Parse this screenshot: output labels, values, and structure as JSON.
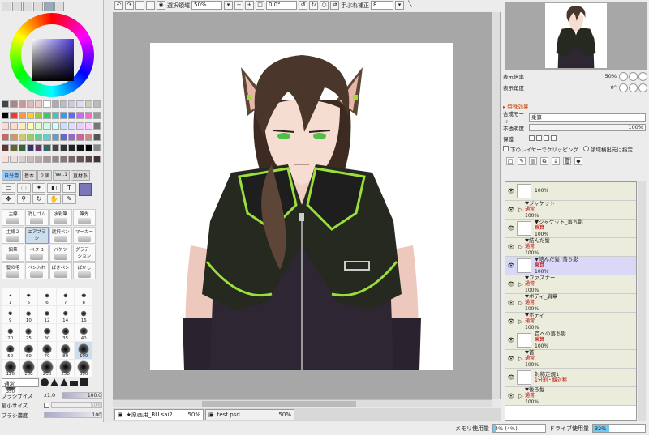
{
  "toolbar": {
    "selection_label": "選択領域",
    "zoom": "50%",
    "rotation": "0.0°",
    "stabilizer_label": "手ぶれ補正",
    "stabilizer_value": "8"
  },
  "left": {
    "tool_tabs": [
      "自分用",
      "基本",
      "２値",
      "Ver.1",
      "直材系"
    ],
    "brushes": [
      {
        "label": "主線"
      },
      {
        "label": "消しゴム"
      },
      {
        "label": "水彩筆"
      },
      {
        "label": "筆先"
      },
      {
        "label": "主線２"
      },
      {
        "label": "エアブラシ",
        "selected": true
      },
      {
        "label": "選択ペン"
      },
      {
        "label": "マーカー"
      },
      {
        "label": "鉛筆"
      },
      {
        "label": "ベタ B"
      },
      {
        "label": "バケツ"
      },
      {
        "label": "グラデーション"
      },
      {
        "label": "髪の毛"
      },
      {
        "label": "ペン入れ"
      },
      {
        "label": "ぼきペン"
      },
      {
        "label": "ぼかし"
      }
    ],
    "sizes": [
      "1",
      "5",
      "6",
      "7",
      "8",
      "9",
      "10",
      "12",
      "14",
      "16",
      "20",
      "25",
      "30",
      "35",
      "40",
      "50",
      "60",
      "70",
      "80",
      "100",
      "120",
      "160",
      "200",
      "250",
      "300",
      "350"
    ],
    "selected_size": "100",
    "mode": "通常",
    "brush_size_label": "ブラシサイズ",
    "brush_size_mult": "x1.0",
    "brush_size_value": "100.0",
    "min_size_label": "最小サイズ",
    "min_size_value": "50%",
    "density_label": "ブラシ濃度",
    "density_value": "100"
  },
  "navigator": {
    "zoom_label": "表示倍率",
    "zoom_value": "50%",
    "angle_label": "表示角度",
    "angle_value": "0°"
  },
  "layer_props": {
    "section": "▸ 特殊効果",
    "blend_label": "合成モード",
    "blend_value": "乗算",
    "opacity_label": "不透明度",
    "opacity_value": "100%",
    "protect_label": "保護",
    "clip_label": "下のレイヤーでクリッピング",
    "detect_label": "領域検出元に指定"
  },
  "layers": [
    {
      "name": "",
      "mode": "",
      "opacity": "100%",
      "folder": false
    },
    {
      "name": "▼ジャケット",
      "mode": "通常",
      "opacity": "100%",
      "folder": true
    },
    {
      "name": "▼ジャケット_落ち影",
      "mode": "乗算",
      "opacity": "100%",
      "folder": false
    },
    {
      "name": "▼結んだ髪",
      "mode": "通常",
      "opacity": "100%",
      "folder": true
    },
    {
      "name": "▼結んだ髪_落ち影",
      "mode": "乗算",
      "opacity": "100%",
      "folder": false,
      "selected": true
    },
    {
      "name": "▼ファスナー",
      "mode": "通常",
      "opacity": "100%",
      "folder": true
    },
    {
      "name": "▼ボディ_肩章",
      "mode": "通常",
      "opacity": "100%",
      "folder": true
    },
    {
      "name": "▼ボディ",
      "mode": "通常",
      "opacity": "100%",
      "folder": true
    },
    {
      "name": "首への落ち影",
      "mode": "乗算",
      "opacity": "100%",
      "folder": false
    },
    {
      "name": "▼首",
      "mode": "通常",
      "opacity": "100%",
      "folder": true
    },
    {
      "name": "対称定規1",
      "mode": "1分割・線対称",
      "opacity": "",
      "folder": false
    },
    {
      "name": "▼後ろ髪",
      "mode": "通常",
      "opacity": "100%",
      "folder": true
    }
  ],
  "files": [
    {
      "name": "★原画用_BU.sai2",
      "zoom": "50%",
      "active": true
    },
    {
      "name": "test.psd",
      "zoom": "50%",
      "active": false
    }
  ],
  "status": {
    "mem_label": "メモリ使用量",
    "mem_value": "4% (4%)",
    "mem_fraction": 0.04,
    "drive_label": "ドライブ使用量",
    "drive_value": "32%",
    "drive_fraction": 0.32
  },
  "colors": {
    "current": "#7a76b7",
    "accent": "#6fc7f2"
  }
}
